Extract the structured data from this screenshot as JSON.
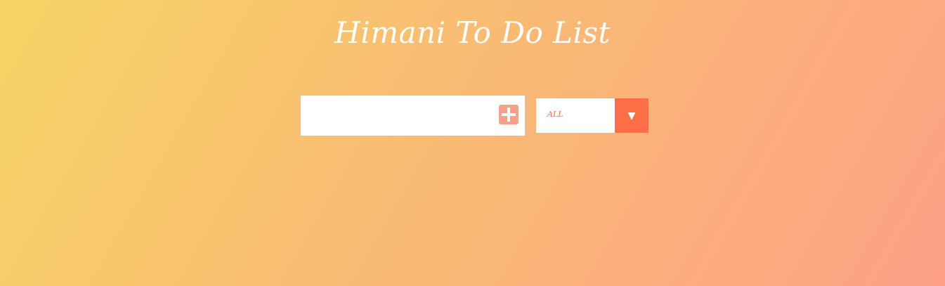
{
  "header": {
    "title": "Himani To Do List"
  },
  "todo_form": {
    "input_value": "",
    "input_placeholder": "",
    "add_button_icon": "plus-icon"
  },
  "filter": {
    "selected": "ALL",
    "dropdown_icon": "caret-down-icon"
  },
  "colors": {
    "gradient_start": "#f6d365",
    "gradient_end": "#fda085",
    "accent": "#ff6f47",
    "add_button": "#f7a08a",
    "surface": "#ffffff"
  }
}
